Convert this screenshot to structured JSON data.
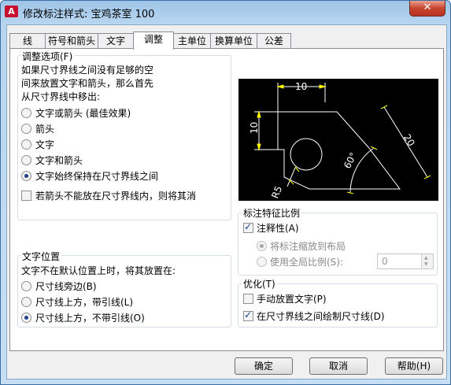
{
  "window": {
    "title": "修改标注样式: 宝鸡茶室 100",
    "app_icon": "A",
    "close_glyph": "✕"
  },
  "tabs": [
    "线",
    "符号和箭头",
    "文字",
    "调整",
    "主单位",
    "换算单位",
    "公差"
  ],
  "active_tab": "调整",
  "fit_options": {
    "title": "调整选项(F)",
    "description": [
      "如果尺寸界线之间没有足够的空",
      "间来放置文字和箭头，那么首先",
      "从尺寸界线中移出:"
    ],
    "radios": [
      {
        "label": "文字或箭头 (最佳效果)",
        "selected": false
      },
      {
        "label": "箭头",
        "selected": false
      },
      {
        "label": "文字",
        "selected": false
      },
      {
        "label": "文字和箭头",
        "selected": false
      },
      {
        "label": "文字始终保持在尺寸界线之间",
        "selected": true
      }
    ],
    "suppress_checkbox": {
      "label": "若箭头不能放在尺寸界线内，则将其消",
      "checked": false
    }
  },
  "text_placement": {
    "title": "文字位置",
    "description": "文字不在默认位置上时，将其放置在:",
    "radios": [
      {
        "label": "尺寸线旁边(B)",
        "selected": false
      },
      {
        "label": "尺寸线上方，带引线(L)",
        "selected": false
      },
      {
        "label": "尺寸线上方，不带引线(O)",
        "selected": true
      }
    ]
  },
  "preview": {
    "labels": [
      "10",
      "10",
      "20",
      "60°",
      "R5"
    ],
    "line_color": "#ffffff",
    "arrow_color": "#ffff00",
    "background": "#000000"
  },
  "scale": {
    "title": "标注特征比例",
    "annotative": {
      "label": "注释性(A)",
      "checked": true
    },
    "scale_to_layout": {
      "label": "将标注缩放到布局",
      "selected": true
    },
    "use_overall": {
      "label": "使用全局比例(S):",
      "selected": false
    },
    "overall_value": "0"
  },
  "fine_tuning": {
    "title": "优化(T)",
    "manual_text": {
      "label": "手动放置文字(P)",
      "checked": false
    },
    "draw_dim_line": {
      "label": "在尺寸界线之间绘制尺寸线(D)",
      "checked": true
    }
  },
  "buttons": {
    "ok": "确定",
    "cancel": "取消",
    "help": "帮助(H)"
  }
}
